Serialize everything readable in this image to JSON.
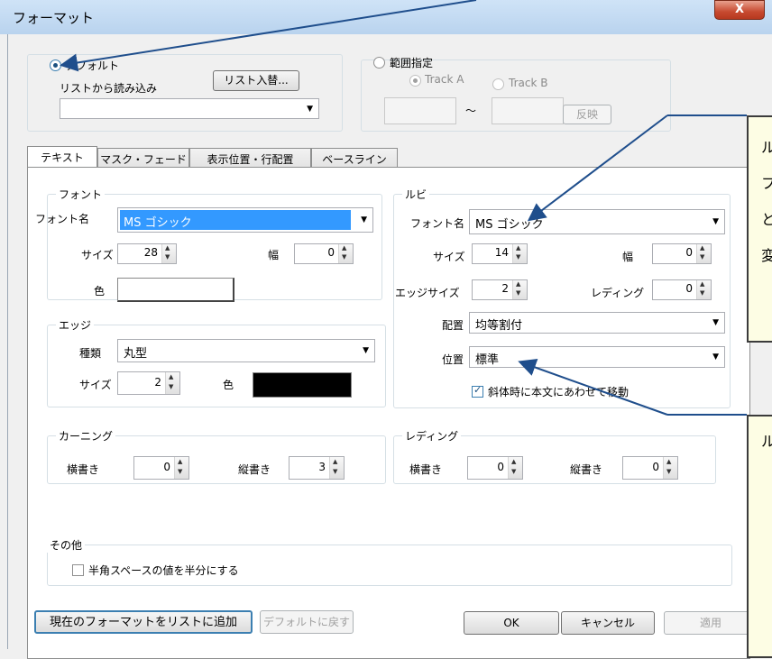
{
  "window": {
    "title": "フォーマット",
    "close": "X"
  },
  "source": {
    "default_label": "デフォルト",
    "list_load_label": "リストから読み込み",
    "list_swap_button": "リスト入替...",
    "range_label": "範囲指定",
    "track_a": "Track A",
    "track_b": "Track B",
    "tilde": "～",
    "reflect_button": "反映"
  },
  "tabs": [
    "テキスト",
    "マスク・フェード",
    "表示位置・行配置",
    "ベースライン"
  ],
  "font": {
    "group": "フォント",
    "name_label": "フォント名",
    "name_value": "MS ゴシック",
    "size_label": "サイズ",
    "size_value": "28",
    "width_label": "幅",
    "width_value": "0",
    "color_label": "色"
  },
  "edge": {
    "group": "エッジ",
    "type_label": "種類",
    "type_value": "丸型",
    "size_label": "サイズ",
    "size_value": "2",
    "color_label": "色"
  },
  "ruby": {
    "group": "ルビ",
    "name_label": "フォント名",
    "name_value": "MS ゴシック",
    "size_label": "サイズ",
    "size_value": "14",
    "width_label": "幅",
    "width_value": "0",
    "edge_label": "エッジサイズ",
    "edge_value": "2",
    "leading_label": "レディング",
    "leading_value": "0",
    "align_label": "配置",
    "align_value": "均等割付",
    "pos_label": "位置",
    "pos_value": "標準",
    "italic_check": "斜体時に本文にあわせて移動"
  },
  "kerning": {
    "group": "カーニング",
    "h_label": "横書き",
    "h_value": "0",
    "v_label": "縦書き",
    "v_value": "3"
  },
  "leading": {
    "group": "レディング",
    "h_label": "横書き",
    "h_value": "0",
    "v_label": "縦書き",
    "v_value": "0"
  },
  "other": {
    "group": "その他",
    "halfwidth_check": "半角スペースの値を半分にする"
  },
  "buttons": {
    "add_to_list": "現在のフォーマットをリストに追加",
    "reset_default": "デフォルトに戻す",
    "ok": "OK",
    "cancel": "キャンセル",
    "apply": "適用"
  },
  "callouts": {
    "top_lines": [
      "ル",
      "フ",
      "と",
      "変"
    ],
    "bottom_lines": [
      "ル"
    ]
  },
  "colors": {
    "font_color": "#ffffff",
    "edge_color": "#000000",
    "highlight": "#3399ff",
    "callout_bg": "#fdfde4"
  }
}
